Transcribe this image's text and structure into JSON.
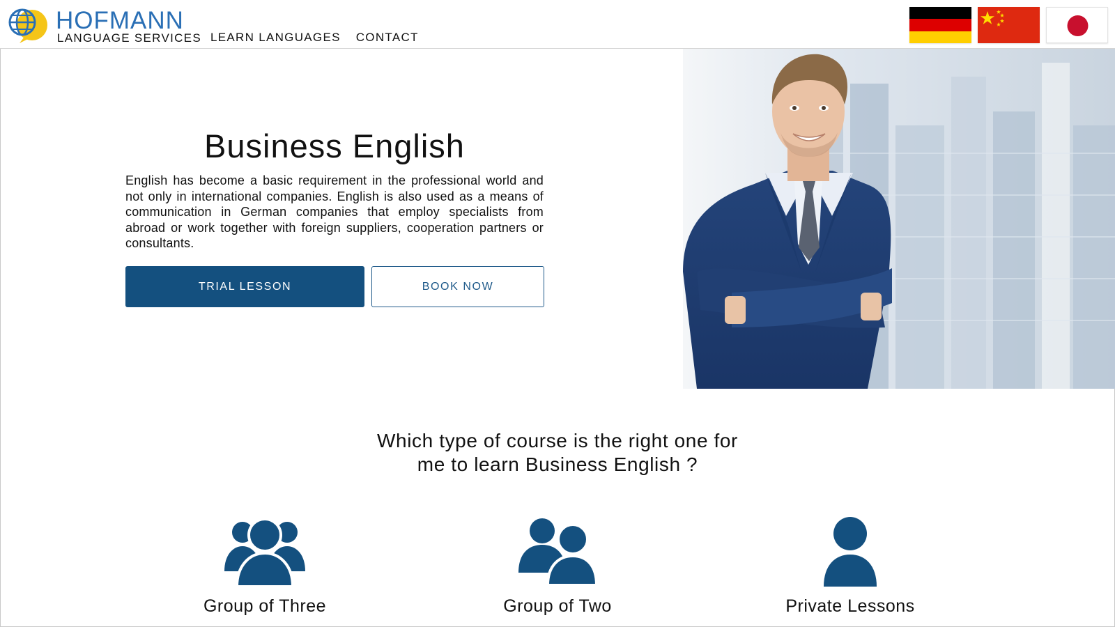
{
  "brand": {
    "name": "HOFMANN",
    "subtitle": "LANGUAGE SERVICES"
  },
  "nav": {
    "items": [
      {
        "label": "LEARN LANGUAGES"
      },
      {
        "label": "CONTACT"
      }
    ]
  },
  "languages": [
    {
      "icon": "germany-flag-icon"
    },
    {
      "icon": "china-flag-icon"
    },
    {
      "icon": "japan-flag-icon"
    }
  ],
  "hero": {
    "title": "Business English",
    "text": "English has become a basic requirement in the professional world and not only in international companies. English is also used as a means of communication in German companies that employ specialists from abroad or work together with foreign suppliers, cooperation partners or consultants.",
    "primary_button": "TRIAL LESSON",
    "secondary_button": "BOOK NOW",
    "image": "business-man-photo"
  },
  "courses": {
    "heading_line1": "Which type of course is the right one for",
    "heading_line2": "me to learn Business English ?",
    "items": [
      {
        "label": "Group of Three",
        "icon": "group-of-three-icon"
      },
      {
        "label": "Group of Two",
        "icon": "group-of-two-icon"
      },
      {
        "label": "Private Lessons",
        "icon": "single-person-icon"
      }
    ]
  },
  "colors": {
    "brand_blue": "#2a6fb5",
    "primary_button": "#14507f",
    "icon_blue": "#14507f",
    "logo_yellow": "#f5c518"
  }
}
